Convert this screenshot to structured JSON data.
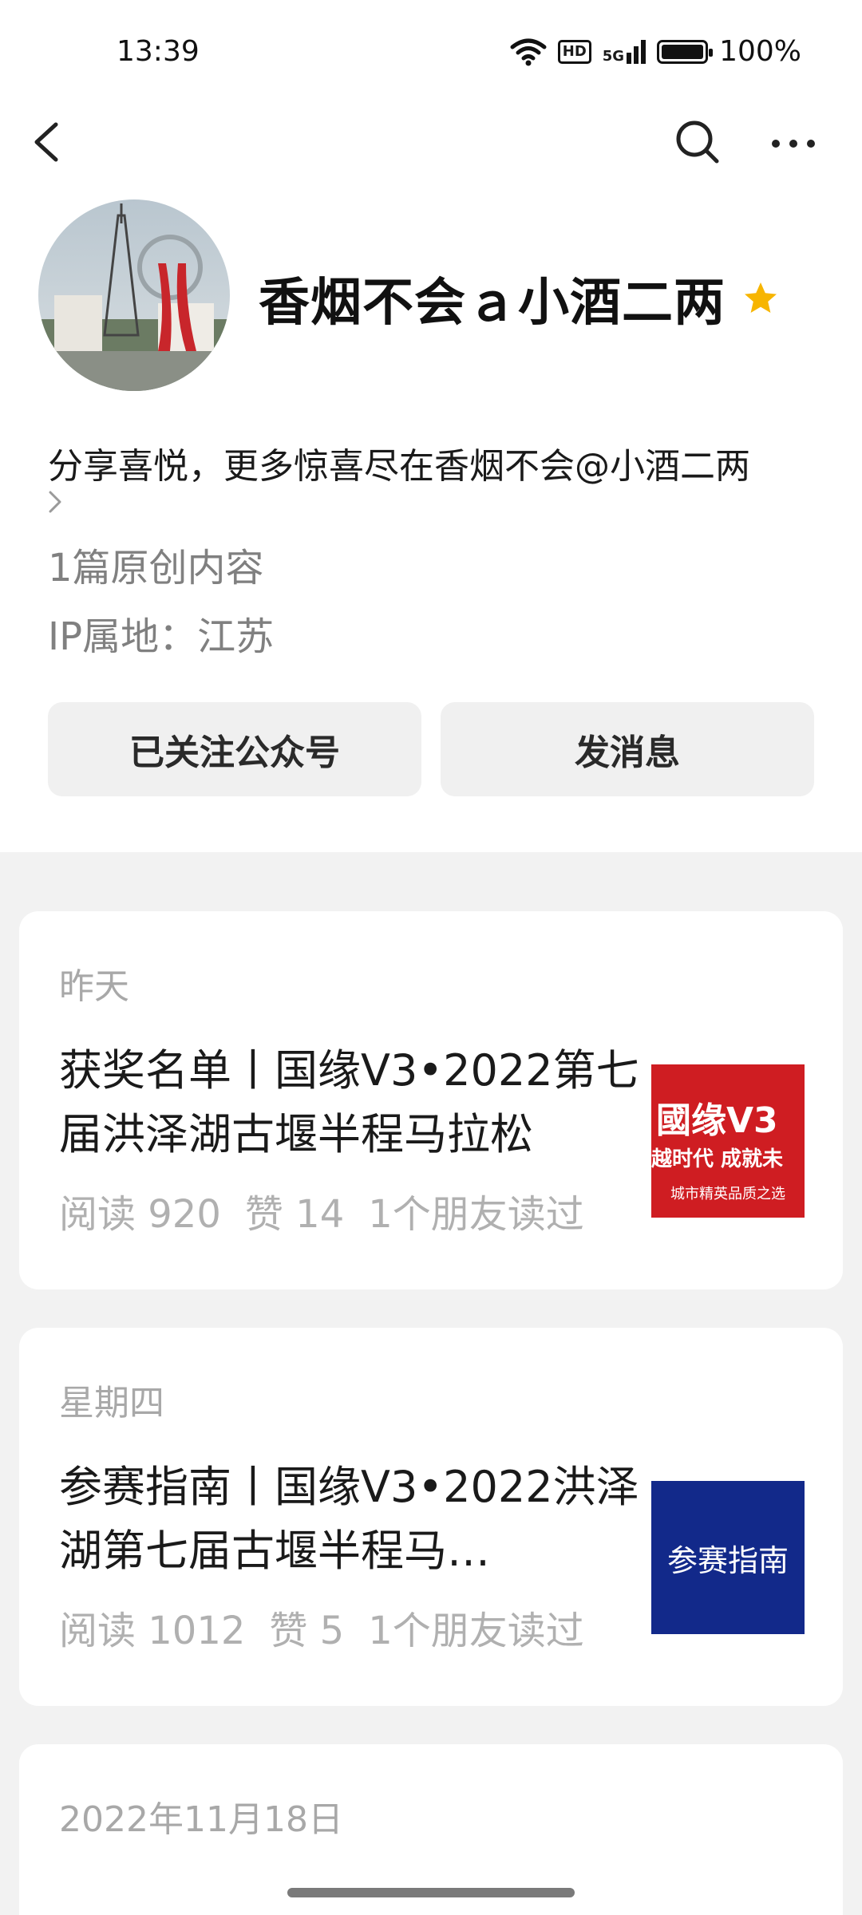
{
  "status_bar": {
    "time": "13:39",
    "network_badge": "HD",
    "signal_label": "5G",
    "battery_percent": "100%",
    "battery_level": 1.0
  },
  "nav": {
    "back_icon": "chevron-left-icon",
    "search_icon": "search-icon",
    "more_icon": "more-icon"
  },
  "profile": {
    "name": "香烟不会ａ小酒二两",
    "verified_icon": "star-icon",
    "star_color": "#f7b500",
    "description": "分享喜悦，更多惊喜尽在香烟不会@小酒二两",
    "original_count": "1篇原创内容",
    "ip_location": "IP属地：江苏"
  },
  "actions": {
    "follow_label": "已关注公众号",
    "message_label": "发消息"
  },
  "articles": [
    {
      "date": "昨天",
      "title": "获奖名单丨国缘V3•2022第七届洪泽湖古堰半程马拉松",
      "reads": "阅读 920",
      "likes": "赞 14",
      "friends": "1个朋友读过",
      "thumb_line1": "國缘V3",
      "thumb_line2": "越时代 成就未",
      "thumb_line3": "城市精英品质之选",
      "thumb_color": "#cf1d22"
    },
    {
      "date": "星期四",
      "title": "参赛指南丨国缘V3•2022洪泽湖第七届古堰半程马…",
      "reads": "阅读 1012",
      "likes": "赞 5",
      "friends": "1个朋友读过",
      "thumb_text": "参赛指南",
      "thumb_color": "#12298a"
    },
    {
      "date": "2022年11月18日"
    }
  ]
}
